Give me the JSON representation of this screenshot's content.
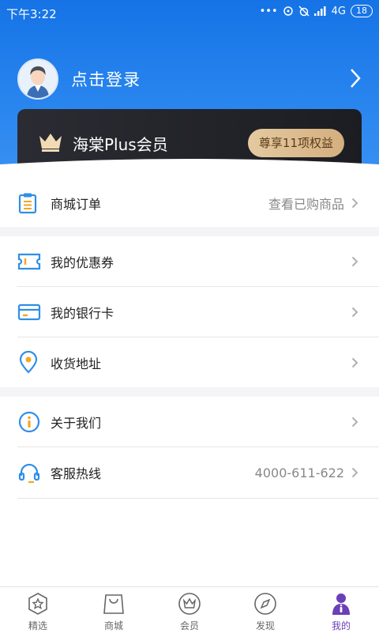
{
  "status_bar": {
    "time": "下午3:22",
    "network": "4G",
    "battery": "18"
  },
  "profile": {
    "login_label": "点击登录"
  },
  "plus_card": {
    "title": "海棠Plus会员",
    "badge": "尊享11项权益"
  },
  "orders": {
    "label": "商城订单",
    "value": "查看已购商品"
  },
  "menu_group_1": [
    {
      "label": "我的优惠券"
    },
    {
      "label": "我的银行卡"
    },
    {
      "label": "收货地址"
    }
  ],
  "menu_group_2": {
    "about": {
      "label": "关于我们"
    },
    "hotline": {
      "label": "客服热线",
      "value": "4000-611-622"
    }
  },
  "tabbar": [
    {
      "label": "精选",
      "icon": "star-icon"
    },
    {
      "label": "商城",
      "icon": "shopping-bag-icon"
    },
    {
      "label": "会员",
      "icon": "crown-icon"
    },
    {
      "label": "发现",
      "icon": "compass-icon"
    },
    {
      "label": "我的",
      "icon": "person-icon",
      "active": true
    }
  ],
  "colors": {
    "primary_blue": "#1573e6",
    "icon_blue": "#2f8fe8",
    "icon_yellow": "#f5a623",
    "active_tab": "#6a3fb8"
  }
}
